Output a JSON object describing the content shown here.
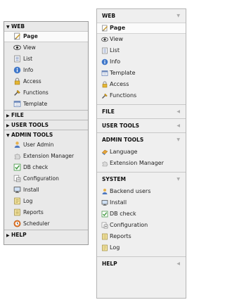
{
  "left_menu": {
    "sections": [
      {
        "title": "WEB",
        "expanded": true,
        "items": [
          {
            "label": "Page",
            "icon": "page-icon",
            "active": true
          },
          {
            "label": "View",
            "icon": "view-icon"
          },
          {
            "label": "List",
            "icon": "list-icon"
          },
          {
            "label": "Info",
            "icon": "info-icon"
          },
          {
            "label": "Access",
            "icon": "access-icon"
          },
          {
            "label": "Functions",
            "icon": "functions-icon"
          },
          {
            "label": "Template",
            "icon": "template-icon"
          }
        ]
      },
      {
        "title": "FILE",
        "expanded": false,
        "items": []
      },
      {
        "title": "USER TOOLS",
        "expanded": false,
        "items": []
      },
      {
        "title": "ADMIN TOOLS",
        "expanded": true,
        "items": [
          {
            "label": "User Admin",
            "icon": "user-admin-icon"
          },
          {
            "label": "Extension Manager",
            "icon": "extension-manager-icon"
          },
          {
            "label": "DB check",
            "icon": "db-check-icon"
          },
          {
            "label": "Configuration",
            "icon": "configuration-icon"
          },
          {
            "label": "Install",
            "icon": "install-icon"
          },
          {
            "label": "Log",
            "icon": "log-icon"
          },
          {
            "label": "Reports",
            "icon": "reports-icon"
          },
          {
            "label": "Scheduler",
            "icon": "scheduler-icon"
          }
        ]
      },
      {
        "title": "HELP",
        "expanded": false,
        "items": []
      }
    ]
  },
  "right_menu": {
    "sections": [
      {
        "title": "WEB",
        "expanded": true,
        "items": [
          {
            "label": "Page",
            "icon": "page-icon",
            "active": true
          },
          {
            "label": "View",
            "icon": "view-icon"
          },
          {
            "label": "List",
            "icon": "list-icon"
          },
          {
            "label": "Info",
            "icon": "info-icon"
          },
          {
            "label": "Template",
            "icon": "template-icon"
          },
          {
            "label": "Access",
            "icon": "access-icon"
          },
          {
            "label": "Functions",
            "icon": "functions-icon"
          }
        ]
      },
      {
        "title": "FILE",
        "expanded": false,
        "items": []
      },
      {
        "title": "USER TOOLS",
        "expanded": false,
        "items": []
      },
      {
        "title": "ADMIN TOOLS",
        "expanded": true,
        "items": [
          {
            "label": "Language",
            "icon": "language-icon"
          },
          {
            "label": "Extension Manager",
            "icon": "extension-manager-icon"
          }
        ]
      },
      {
        "title": "SYSTEM",
        "expanded": true,
        "items": [
          {
            "label": "Backend users",
            "icon": "backend-users-icon"
          },
          {
            "label": "Install",
            "icon": "install-icon"
          },
          {
            "label": "DB check",
            "icon": "db-check-icon"
          },
          {
            "label": "Configuration",
            "icon": "configuration-icon"
          },
          {
            "label": "Reports",
            "icon": "reports-icon"
          },
          {
            "label": "Log",
            "icon": "log-icon"
          }
        ]
      },
      {
        "title": "HELP",
        "expanded": false,
        "items": []
      }
    ]
  }
}
